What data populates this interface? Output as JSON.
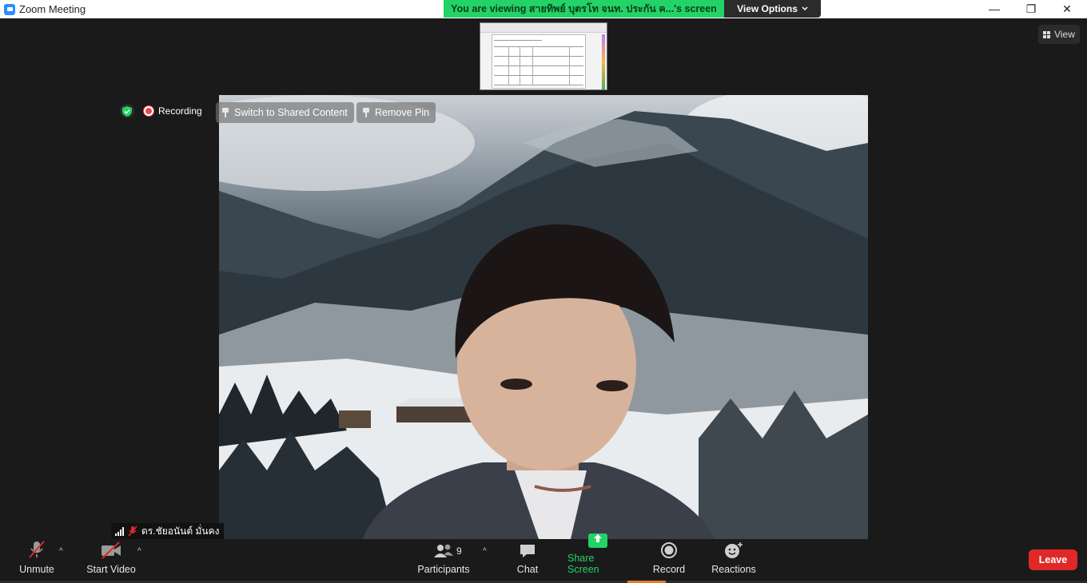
{
  "window": {
    "title": "Zoom Meeting",
    "minimize_glyph": "—",
    "restore_glyph": "❐",
    "close_glyph": "✕"
  },
  "banner": {
    "viewing_text": "You are viewing สายทิพย์ บุตรโท จนท. ประกัน ค...'s screen",
    "view_options_label": "View Options",
    "view_options_icon": "chevron-down-icon"
  },
  "view_button": {
    "label": "View",
    "icon": "grid-icon"
  },
  "status": {
    "recording_label": "Recording",
    "security_icon": "shield-check-icon",
    "colors": {
      "shield": "#23d366",
      "recording_dot": "#e5484d"
    }
  },
  "video_overlay": {
    "switch_label": "Switch to Shared Content",
    "remove_pin_label": "Remove Pin"
  },
  "participant": {
    "name": "ดร.ชัยอนันต์ มั่นคง",
    "muted": true
  },
  "toolbar": {
    "unmute_label": "Unmute",
    "start_video_label": "Start Video",
    "participants_label": "Participants",
    "participants_count": "9",
    "chat_label": "Chat",
    "share_screen_label": "Share Screen",
    "record_label": "Record",
    "reactions_label": "Reactions",
    "leave_label": "Leave",
    "caret_glyph": "^"
  },
  "colors": {
    "accent_green": "#23d366",
    "leave_red": "#e02828",
    "background": "#1a1a1a"
  }
}
